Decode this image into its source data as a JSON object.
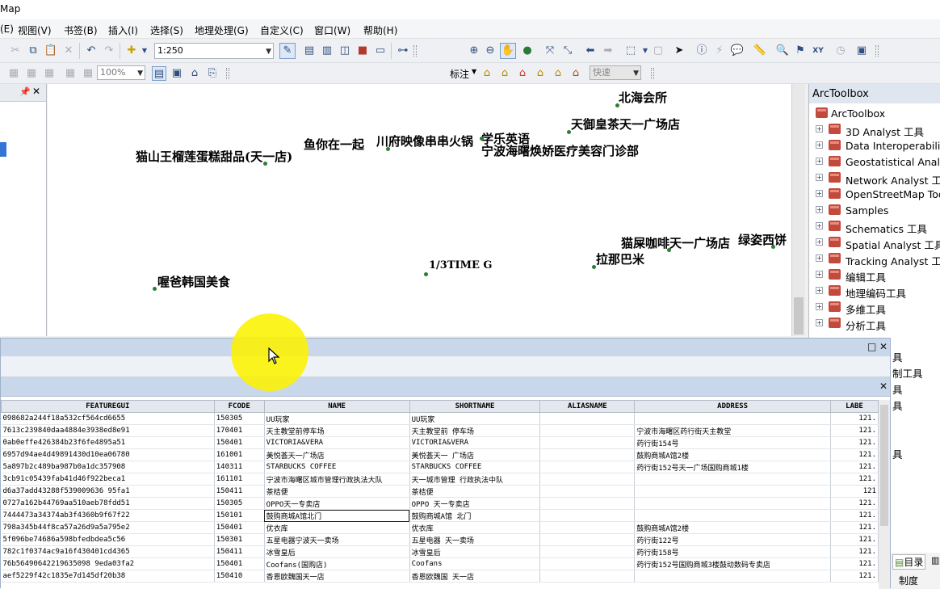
{
  "window": {
    "title": "Map"
  },
  "menu": [
    "(E)",
    "视图(V)",
    "书签(B)",
    "插入(I)",
    "选择(S)",
    "地理处理(G)",
    "自定义(C)",
    "窗口(W)",
    "帮助(H)"
  ],
  "toolbar": {
    "scale": "1:250",
    "zoom": "100%",
    "label_menu": "标注",
    "quick": "快速"
  },
  "map": {
    "labels": [
      "北海会所",
      "天御皇茶天一广场店",
      "鱼你在一起",
      "川府映像串串火锅",
      "学乐英语",
      "宁波海曙焕娇医疗美容门诊部",
      "猫山王榴莲蛋糕甜品(天一店)",
      "猫屎咖啡天一广场店",
      "绿姿西饼",
      "拉那巴米",
      "1/3TIME G",
      "喔爸韩国美食"
    ]
  },
  "arctoolbox": {
    "title": "ArcToolbox",
    "root": "ArcToolbox",
    "items": [
      "3D Analyst 工具",
      "Data Interoperability",
      "Geostatistical Analys",
      "Network Analyst 工具",
      "OpenStreetMap Too",
      "Samples",
      "Schematics 工具",
      "Spatial Analyst 工具",
      "Tracking Analyst 工具",
      "编辑工具",
      "地理编码工具",
      "多维工具",
      "分析工具"
    ],
    "peek": [
      "具",
      "制工具",
      "具",
      "具",
      "具"
    ]
  },
  "bottom_tabs": {
    "catalog": "目录",
    "extra": "制度"
  },
  "table": {
    "columns": [
      "FEATUREGUI",
      "FCODE",
      "NAME",
      "SHORTNAME",
      "ALIASNAME",
      "ADDRESS",
      "LABE"
    ],
    "rows": [
      [
        "098682a244f18a532cf564cd6655",
        "150305",
        "UU玩家",
        "UU玩家",
        "",
        "",
        "121."
      ],
      [
        "7613c239840daa4884e3938ed8e91",
        "170401",
        "天主教堂前停车场",
        "天主教堂前 停车场",
        "",
        "宁波市海曙区药行街天主教堂",
        "121."
      ],
      [
        "0ab0effe426384b23f6fe4895a51",
        "150401",
        "VICTORIA&VERA",
        "VICTORIA&VERA",
        "",
        "药行街154号",
        "121."
      ],
      [
        "6957d94ae4d49891430d10ea06780",
        "161001",
        "美悦荟天一广场店",
        "美悦荟天一 广场店",
        "",
        "鼓购商城A馆2楼",
        "121."
      ],
      [
        "5a897b2c489ba987b0a1dc357908",
        "140311",
        "STARBUCKS COFFEE",
        "STARBUCKS COFFEE",
        "",
        "药行街152号天一广场国购商城1楼",
        "121."
      ],
      [
        "3cb91c05439fab41d46f922beca1",
        "161101",
        "宁波市海曙区城市管理行政执法大队",
        "天一城市管理 行政执法中队",
        "",
        "",
        "121."
      ],
      [
        "d6a37add43288f539009636 95fa1",
        "150411",
        "茶桔便",
        "茶桔便",
        "",
        "",
        "121"
      ],
      [
        "0727a162b44769aa510aeb78fdd51",
        "150305",
        "OPPO天一专卖店",
        "OPPO 天一专卖店",
        "",
        "",
        "121."
      ],
      [
        "7444473a34374ab3f4360b9f67f22",
        "150101",
        "鼓购商城A馆北门",
        "鼓购商城A馆 北门",
        "",
        "",
        "121."
      ],
      [
        "798a345b44f8ca57a26d9a5a795e2",
        "150401",
        "优衣库",
        "优衣库",
        "",
        "鼓购商城A馆2楼",
        "121."
      ],
      [
        "5f096be74686a598bfedbdea5c56",
        "150301",
        "五星电器宁波天一卖场",
        "五星电器 天一卖场",
        "",
        "药行街122号",
        "121."
      ],
      [
        "782c1f0374ac9a16f430401cd4365",
        "150411",
        "冰雪皇后",
        "冰雪皇后",
        "",
        "药行街158号",
        "121."
      ],
      [
        "76b56490642219635098 9eda03fa2",
        "150401",
        "Coofans(国购店)",
        "Coofans",
        "",
        "药行街152号国购商城3楼鼓动数码专卖店",
        "121."
      ],
      [
        "aef5229f42c1835e7d145df20b38",
        "150410",
        "香恩欧魏国天一店",
        "香恩欧魏国 天一店",
        "",
        "",
        "121."
      ]
    ]
  },
  "colors": {
    "accent": "#c9d7ea",
    "highlight": "#fcf300",
    "point": "#2e7d32"
  }
}
